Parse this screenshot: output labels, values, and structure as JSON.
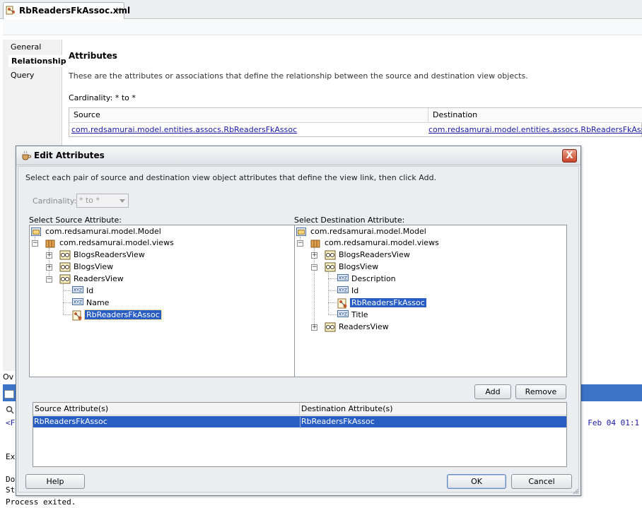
{
  "editor": {
    "tab_title": "RbReadersFkAssoc.xml",
    "tab_close": "×",
    "nav": [
      "General",
      "Relationship",
      "Query"
    ],
    "section_title": "Attributes",
    "section_desc": "These are the attributes or associations that define the relationship between the source and destination view objects.",
    "cardinality_label": "Cardinality: * to *",
    "table": {
      "headers": [
        "Source",
        "Destination"
      ],
      "row": [
        "com.redsamurai.model.entities.assocs.RbReadersFkAssoc",
        "com.redsamurai.model.entities.assocs.RbReadersFkAssoc"
      ]
    }
  },
  "log": {
    "tab_fragment": "Ov",
    "line_f": "<F",
    "line_date": ": Feb 04 01:1",
    "line_ex": "Ex",
    "line_do": "Do",
    "line_st": "St",
    "line_exit": "Process exited."
  },
  "dialog": {
    "title": "Edit Attributes",
    "close": "X",
    "instruction": "Select each pair of source and destination view object attributes that define the view link, then click Add.",
    "cardinality_label": "Cardinality:",
    "cardinality_value": "* to *",
    "source_label": "Select Source Attribute:",
    "dest_label": "Select Destination Attribute:",
    "source_tree": {
      "model": "com.redsamurai.model.Model",
      "views": "com.redsamurai.model.views",
      "blogsreaders": "BlogsReadersView",
      "blogs": "BlogsView",
      "readers": "ReadersView",
      "id": "Id",
      "name": "Name",
      "assoc": "RbReadersFkAssoc"
    },
    "dest_tree": {
      "model": "com.redsamurai.model.Model",
      "views": "com.redsamurai.model.views",
      "blogsreaders": "BlogsReadersView",
      "blogs": "BlogsView",
      "description": "Description",
      "id": "Id",
      "assoc": "RbReadersFkAssoc",
      "title": "Title",
      "readers": "ReadersView"
    },
    "add_button": "Add",
    "remove_button": "Remove",
    "pairs": {
      "headers": [
        "Source Attribute(s)",
        "Destination Attribute(s)"
      ],
      "row": [
        "RbReadersFkAssoc",
        "RbReadersFkAssoc"
      ]
    },
    "help_button": "Help",
    "ok_button": "OK",
    "cancel_button": "Cancel"
  },
  "colors": {
    "selection": "#2a5dc4",
    "link": "#1a1aa6",
    "close_red": "#c9442a"
  }
}
